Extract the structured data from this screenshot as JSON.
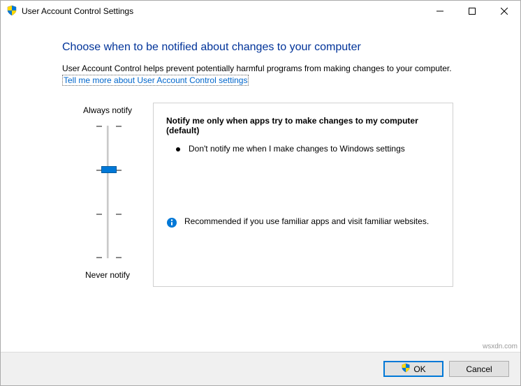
{
  "titlebar": {
    "title": "User Account Control Settings"
  },
  "heading": "Choose when to be notified about changes to your computer",
  "description": "User Account Control helps prevent potentially harmful programs from making changes to your computer.",
  "link_text": "Tell me more about User Account Control settings",
  "slider": {
    "top_label": "Always notify",
    "bottom_label": "Never notify",
    "level": 2,
    "levels": 4
  },
  "panel": {
    "title": "Notify me only when apps try to make changes to my computer (default)",
    "bullet": "Don't notify me when I make changes to Windows settings",
    "recommendation": "Recommended if you use familiar apps and visit familiar websites."
  },
  "buttons": {
    "ok": "OK",
    "cancel": "Cancel"
  },
  "watermark": "wsxdn.com"
}
